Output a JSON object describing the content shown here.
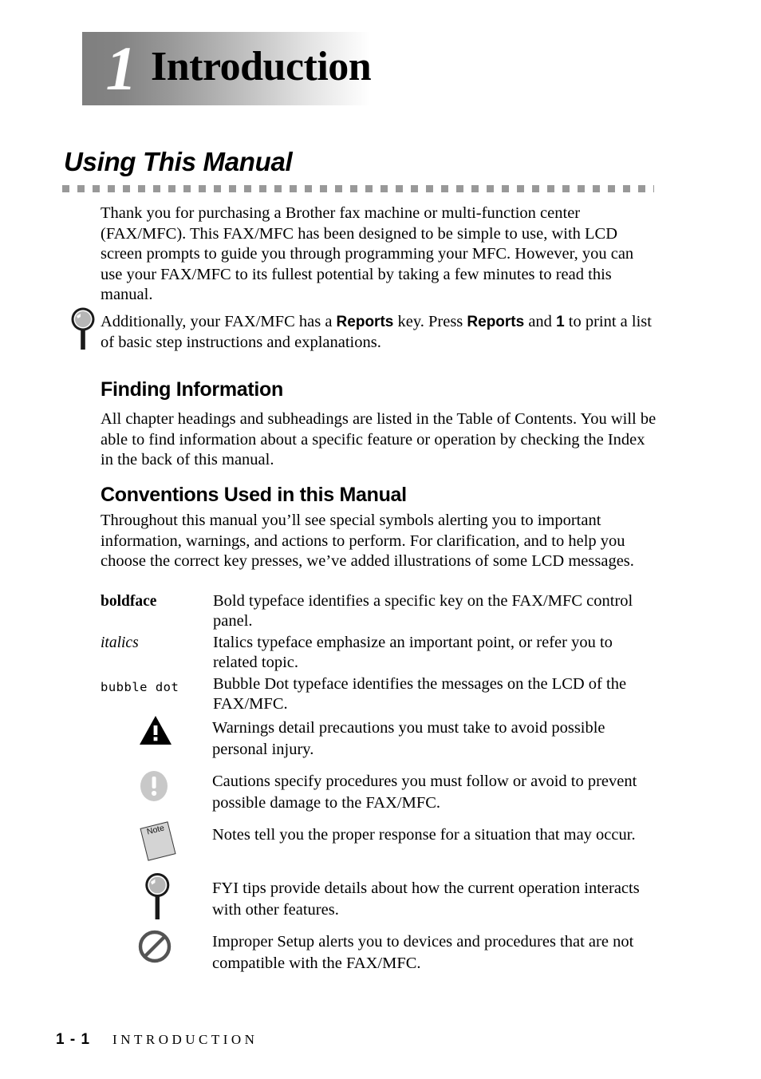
{
  "chapter": {
    "number": "1",
    "title": "Introduction"
  },
  "section": {
    "heading": "Using This Manual"
  },
  "paragraphs": {
    "intro": "Thank you for purchasing a Brother fax machine or multi-function center (FAX/MFC). This FAX/MFC has been designed to be simple to use, with LCD screen prompts to guide you through programming your MFC. However, you can use your FAX/MFC to its fullest potential by taking a few minutes to read this manual.",
    "fyi_before": "Additionally, your FAX/MFC has a ",
    "fyi_key1": "Reports",
    "fyi_mid": " key. Press ",
    "fyi_key2": "Reports",
    "fyi_and": " and ",
    "fyi_key3": "1",
    "fyi_after": " to print a list of basic step instructions and explanations.",
    "finding": "All chapter headings and subheadings are listed in the Table of Contents. You will be able to find information about a specific feature or operation by checking the Index in the back of this manual.",
    "conventions": "Throughout this manual you’ll see special symbols alerting you to important information, warnings, and actions to perform. For clarification, and to help you choose the correct key presses, we’ve added illustrations of some LCD messages."
  },
  "subheadings": {
    "finding": "Finding Information",
    "conventions": "Conventions Used in this Manual"
  },
  "typeface_table": [
    {
      "term": "boldface",
      "style": "bold",
      "description": "Bold typeface identifies a specific key on the FAX/MFC control panel."
    },
    {
      "term": "italics",
      "style": "italic",
      "description": "Italics typeface emphasize an important point, or refer you to related topic."
    },
    {
      "term": "bubble dot",
      "style": "dots",
      "description": "Bubble Dot typeface identifies the messages on the LCD of the FAX/MFC."
    }
  ],
  "symbols": [
    {
      "icon": "warning-triangle-icon",
      "text": "Warnings detail precautions you must take to avoid possible personal injury."
    },
    {
      "icon": "caution-exclamation-icon",
      "text": "Cautions specify procedures you must follow or avoid to prevent possible damage to the FAX/MFC."
    },
    {
      "icon": "note-page-icon",
      "label": "Note",
      "text": "Notes tell you the proper response for a situation that may occur."
    },
    {
      "icon": "fyi-magnifier-icon",
      "text": "FYI tips provide details about how the current operation interacts with other features."
    },
    {
      "icon": "improper-setup-prohibition-icon",
      "text": "Improper Setup alerts you to devices and procedures that are not compatible with the FAX/MFC."
    }
  ],
  "footer": {
    "page": "1 - 1",
    "chapter_name": "INTRODUCTION"
  },
  "colors": {
    "rule_gray": "#999999",
    "header_gradient_start": "#7f7f7f",
    "caution_gray": "#c8c8c8",
    "note_gray": "#d4d4d4"
  }
}
